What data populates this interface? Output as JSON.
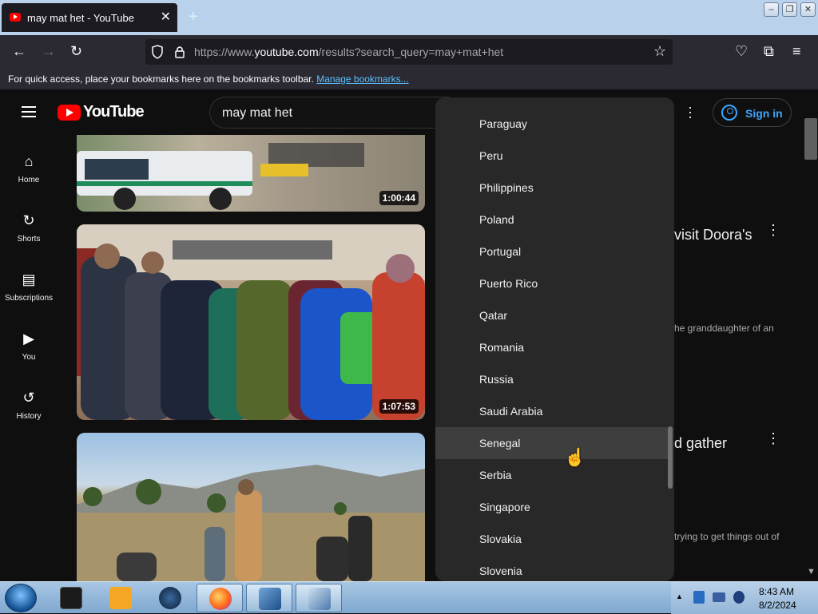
{
  "browser": {
    "tab_title": "may mat het - YouTube",
    "tab_close": "✕",
    "new_tab": "+",
    "url_prefix": "https://www.",
    "url_domain": "youtube.com",
    "url_path": "/results?search_query=may+mat+het",
    "bookmarks_message": "For quick access, place your bookmarks here on the bookmarks toolbar.",
    "bookmarks_link": "Manage bookmarks..."
  },
  "youtube": {
    "logo_text": "YouTube",
    "search_query": "may mat het",
    "sign_in": "Sign in",
    "guide": [
      {
        "label": "Home",
        "icon": "⌂"
      },
      {
        "label": "Shorts",
        "icon": "↻"
      },
      {
        "label": "Subscriptions",
        "icon": "▤"
      },
      {
        "label": "You",
        "icon": "▶"
      },
      {
        "label": "History",
        "icon": "↺"
      }
    ],
    "videos": [
      {
        "duration": "1:00:44"
      },
      {
        "duration": "1:07:53",
        "title_fragment": "visit Doora's",
        "desc_fragment": "he granddaughter of an"
      },
      {
        "title_fragment": "d gather",
        "desc_fragment": "trying to get things out of"
      }
    ]
  },
  "location_menu": {
    "items": [
      "Paraguay",
      "Peru",
      "Philippines",
      "Poland",
      "Portugal",
      "Puerto Rico",
      "Qatar",
      "Romania",
      "Russia",
      "Saudi Arabia",
      "Senegal",
      "Serbia",
      "Singapore",
      "Slovakia",
      "Slovenia"
    ],
    "hovered": "Senegal"
  },
  "taskbar": {
    "time": "8:43 AM",
    "date": "8/2/2024"
  }
}
